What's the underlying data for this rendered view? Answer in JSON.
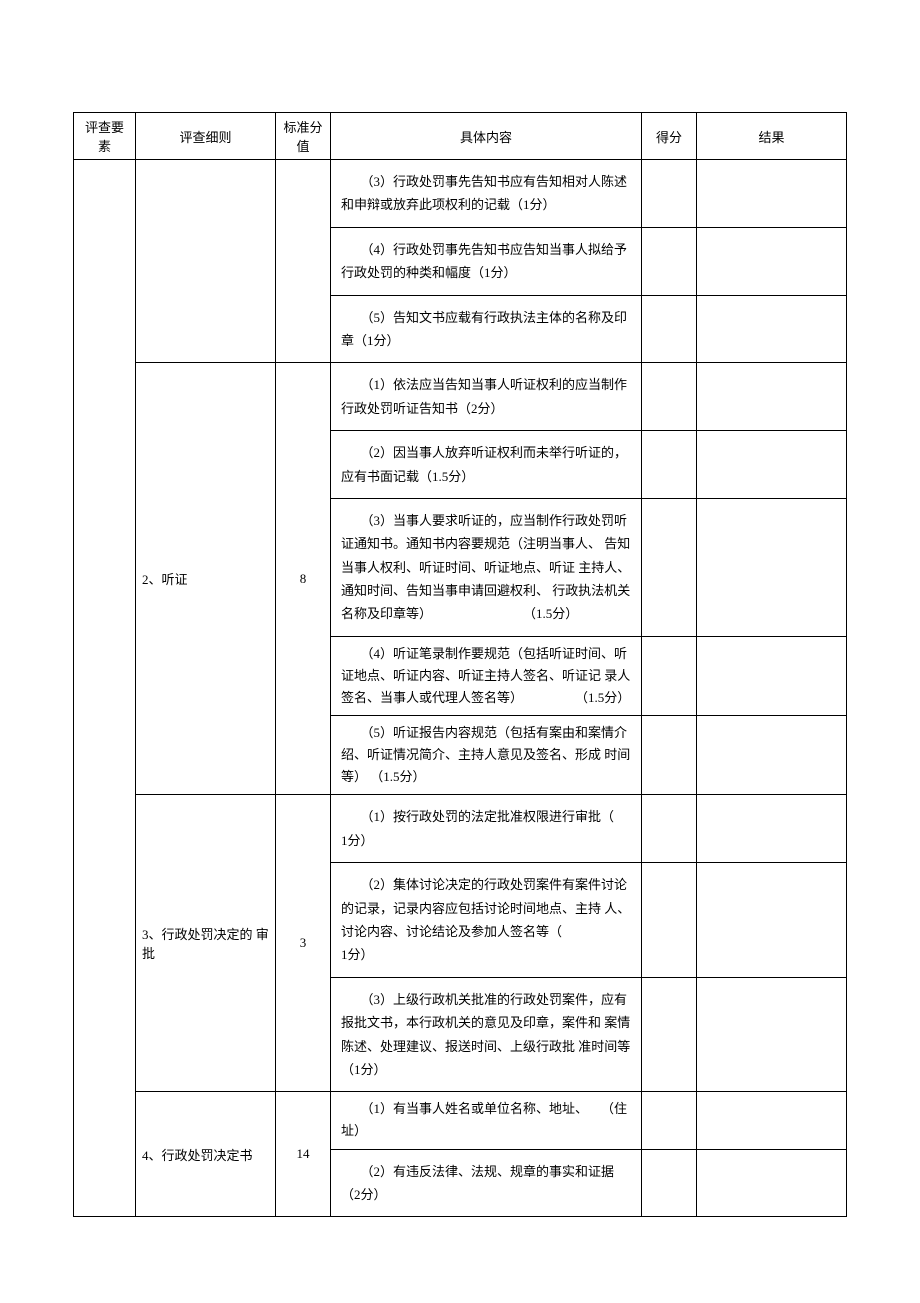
{
  "header": {
    "factor": "评查要素",
    "rule": "评查细则",
    "std_score": "标准分值",
    "content": "具体内容",
    "points": "得分",
    "result": "结果"
  },
  "rows": {
    "r1": {
      "items": {
        "c3": "　　（3）行政处罚事先告知书应有告知相对人陈述 和申辩或放弃此项权利的记载（1分）",
        "c4": "　　（4）行政处罚事先告知书应告知当事人拟给予 行政处罚的种类和幅度（1分）",
        "c5": "　　（5）告知文书应载有行政执法主体的名称及印 章（1分）"
      }
    },
    "r2": {
      "rule": "2、听证",
      "score": "8",
      "items": {
        "c1": "　　（1）依法应当告知当事人听证权利的应当制作 行政处罚听证告知书（2分）",
        "c2": "　　（2）因当事人放弃听证权利而未举行听证的，　应有书面记载（1.5分）",
        "c3": "　　（3）当事人要求听证的，应当制作行政处罚听 证通知书。通知书内容要规范（注明当事人、 告知当事人权利、听证时间、听证地点、听证 主持人、通知时间、告知当事申请回避权利、 行政执法机关名称及印章等）　　　　　　　　（1.5分）",
        "c4": "　　（4）听证笔录制作要规范（包括听证时间、听 证地点、听证内容、听证主持人签名、听证记 录人签名、当事人或代理人签名等）　　　　　（1.5分）",
        "c5": "　　（5）听证报告内容规范（包括有案由和案情介绍、听证情况简介、主持人意见及签名、形成 时间等） （1.5分）"
      }
    },
    "r3": {
      "rule": "3、行政处罚决定的 审批",
      "score": "3",
      "items": {
        "c1": "　　（1）按行政处罚的法定批准权限进行审批（　　1分）",
        "c2": "　　（2）集体讨论决定的行政处罚案件有案件讨论 的记录，记录内容应包括讨论时间地点、主持 人、讨论内容、讨论结论及参加人签名等（　　　　　1分）",
        "c3": "　　（3）上级行政机关批准的行政处罚案件，应有 报批文书，本行政机关的意见及印章，案件和 案情陈述、处理建议、报送时间、上级行政批 准时间等（1分）"
      }
    },
    "r4": {
      "rule": "4、行政处罚决定书",
      "score": "14",
      "items": {
        "c1": "　　（1）有当事人姓名或单位名称、地址、　　（住址）",
        "c2": "　　（2）有违反法律、法规、规章的事实和证据（2分）"
      }
    }
  }
}
